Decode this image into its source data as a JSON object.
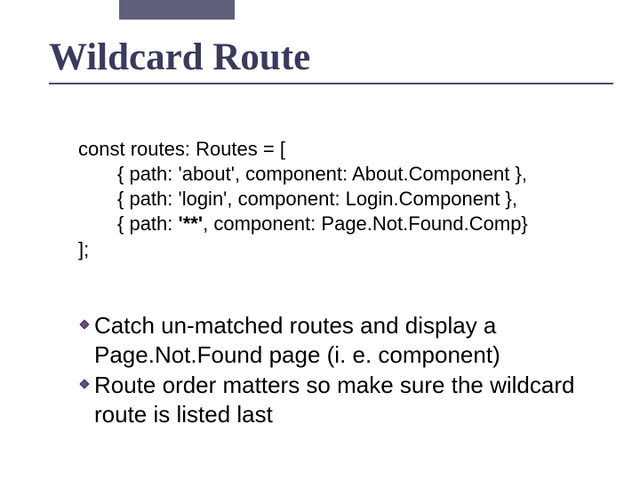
{
  "title": "Wildcard Route",
  "code": {
    "l0": "const routes: Routes = [",
    "l1": "{ path: 'about', component: About.Component },",
    "l2": "{ path: 'login', component: Login.Component },",
    "l3_pre": "{ path: ",
    "l3_bold": "'**'",
    "l3_post": ", component: Page.Not.Found.Comp}",
    "l4": "];"
  },
  "bullets": [
    "Catch un-matched routes and display a Page.Not.Found page (i. e. component)",
    "Route order matters so make sure the wildcard route is listed last"
  ]
}
